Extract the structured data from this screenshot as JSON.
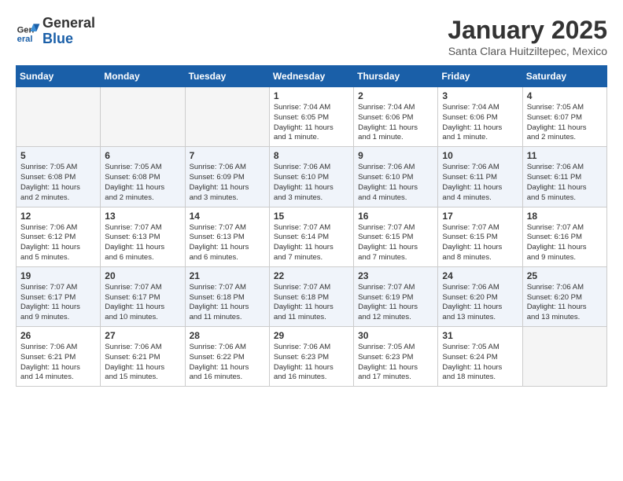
{
  "header": {
    "logo_general": "General",
    "logo_blue": "Blue",
    "month": "January 2025",
    "location": "Santa Clara Huitziltepec, Mexico"
  },
  "days_of_week": [
    "Sunday",
    "Monday",
    "Tuesday",
    "Wednesday",
    "Thursday",
    "Friday",
    "Saturday"
  ],
  "weeks": [
    [
      {
        "day": "",
        "info": ""
      },
      {
        "day": "",
        "info": ""
      },
      {
        "day": "",
        "info": ""
      },
      {
        "day": "1",
        "info": "Sunrise: 7:04 AM\nSunset: 6:05 PM\nDaylight: 11 hours\nand 1 minute."
      },
      {
        "day": "2",
        "info": "Sunrise: 7:04 AM\nSunset: 6:06 PM\nDaylight: 11 hours\nand 1 minute."
      },
      {
        "day": "3",
        "info": "Sunrise: 7:04 AM\nSunset: 6:06 PM\nDaylight: 11 hours\nand 1 minute."
      },
      {
        "day": "4",
        "info": "Sunrise: 7:05 AM\nSunset: 6:07 PM\nDaylight: 11 hours\nand 2 minutes."
      }
    ],
    [
      {
        "day": "5",
        "info": "Sunrise: 7:05 AM\nSunset: 6:08 PM\nDaylight: 11 hours\nand 2 minutes."
      },
      {
        "day": "6",
        "info": "Sunrise: 7:05 AM\nSunset: 6:08 PM\nDaylight: 11 hours\nand 2 minutes."
      },
      {
        "day": "7",
        "info": "Sunrise: 7:06 AM\nSunset: 6:09 PM\nDaylight: 11 hours\nand 3 minutes."
      },
      {
        "day": "8",
        "info": "Sunrise: 7:06 AM\nSunset: 6:10 PM\nDaylight: 11 hours\nand 3 minutes."
      },
      {
        "day": "9",
        "info": "Sunrise: 7:06 AM\nSunset: 6:10 PM\nDaylight: 11 hours\nand 4 minutes."
      },
      {
        "day": "10",
        "info": "Sunrise: 7:06 AM\nSunset: 6:11 PM\nDaylight: 11 hours\nand 4 minutes."
      },
      {
        "day": "11",
        "info": "Sunrise: 7:06 AM\nSunset: 6:11 PM\nDaylight: 11 hours\nand 5 minutes."
      }
    ],
    [
      {
        "day": "12",
        "info": "Sunrise: 7:06 AM\nSunset: 6:12 PM\nDaylight: 11 hours\nand 5 minutes."
      },
      {
        "day": "13",
        "info": "Sunrise: 7:07 AM\nSunset: 6:13 PM\nDaylight: 11 hours\nand 6 minutes."
      },
      {
        "day": "14",
        "info": "Sunrise: 7:07 AM\nSunset: 6:13 PM\nDaylight: 11 hours\nand 6 minutes."
      },
      {
        "day": "15",
        "info": "Sunrise: 7:07 AM\nSunset: 6:14 PM\nDaylight: 11 hours\nand 7 minutes."
      },
      {
        "day": "16",
        "info": "Sunrise: 7:07 AM\nSunset: 6:15 PM\nDaylight: 11 hours\nand 7 minutes."
      },
      {
        "day": "17",
        "info": "Sunrise: 7:07 AM\nSunset: 6:15 PM\nDaylight: 11 hours\nand 8 minutes."
      },
      {
        "day": "18",
        "info": "Sunrise: 7:07 AM\nSunset: 6:16 PM\nDaylight: 11 hours\nand 9 minutes."
      }
    ],
    [
      {
        "day": "19",
        "info": "Sunrise: 7:07 AM\nSunset: 6:17 PM\nDaylight: 11 hours\nand 9 minutes."
      },
      {
        "day": "20",
        "info": "Sunrise: 7:07 AM\nSunset: 6:17 PM\nDaylight: 11 hours\nand 10 minutes."
      },
      {
        "day": "21",
        "info": "Sunrise: 7:07 AM\nSunset: 6:18 PM\nDaylight: 11 hours\nand 11 minutes."
      },
      {
        "day": "22",
        "info": "Sunrise: 7:07 AM\nSunset: 6:18 PM\nDaylight: 11 hours\nand 11 minutes."
      },
      {
        "day": "23",
        "info": "Sunrise: 7:07 AM\nSunset: 6:19 PM\nDaylight: 11 hours\nand 12 minutes."
      },
      {
        "day": "24",
        "info": "Sunrise: 7:06 AM\nSunset: 6:20 PM\nDaylight: 11 hours\nand 13 minutes."
      },
      {
        "day": "25",
        "info": "Sunrise: 7:06 AM\nSunset: 6:20 PM\nDaylight: 11 hours\nand 13 minutes."
      }
    ],
    [
      {
        "day": "26",
        "info": "Sunrise: 7:06 AM\nSunset: 6:21 PM\nDaylight: 11 hours\nand 14 minutes."
      },
      {
        "day": "27",
        "info": "Sunrise: 7:06 AM\nSunset: 6:21 PM\nDaylight: 11 hours\nand 15 minutes."
      },
      {
        "day": "28",
        "info": "Sunrise: 7:06 AM\nSunset: 6:22 PM\nDaylight: 11 hours\nand 16 minutes."
      },
      {
        "day": "29",
        "info": "Sunrise: 7:06 AM\nSunset: 6:23 PM\nDaylight: 11 hours\nand 16 minutes."
      },
      {
        "day": "30",
        "info": "Sunrise: 7:05 AM\nSunset: 6:23 PM\nDaylight: 11 hours\nand 17 minutes."
      },
      {
        "day": "31",
        "info": "Sunrise: 7:05 AM\nSunset: 6:24 PM\nDaylight: 11 hours\nand 18 minutes."
      },
      {
        "day": "",
        "info": ""
      }
    ]
  ]
}
